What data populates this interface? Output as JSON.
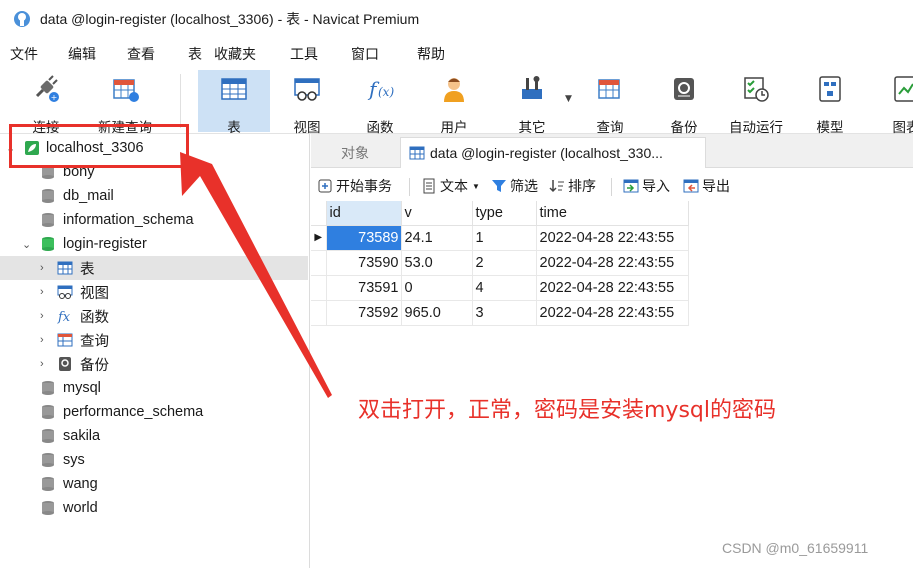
{
  "window": {
    "title": "data @login-register (localhost_3306) - 表 - Navicat Premium"
  },
  "menu": [
    "文件",
    "编辑",
    "查看",
    "表",
    "收藏夹",
    "工具",
    "窗口",
    "帮助"
  ],
  "toolbar": {
    "buttons": [
      {
        "label": "连接",
        "icon": "connection-icon"
      },
      {
        "label": "新建查询",
        "icon": "new-query-icon"
      },
      {
        "label": "表",
        "icon": "table-icon",
        "active": true
      },
      {
        "label": "视图",
        "icon": "view-icon"
      },
      {
        "label": "函数",
        "icon": "function-icon"
      },
      {
        "label": "用户",
        "icon": "user-icon"
      },
      {
        "label": "其它",
        "icon": "tools-icon"
      },
      {
        "label": "查询",
        "icon": "query-icon"
      },
      {
        "label": "备份",
        "icon": "backup-icon"
      },
      {
        "label": "自动运行",
        "icon": "automation-icon"
      },
      {
        "label": "模型",
        "icon": "model-icon"
      },
      {
        "label": "图表",
        "icon": "chart-icon"
      }
    ]
  },
  "sidebar": {
    "connection": "localhost_3306",
    "databases_before": [
      "bony",
      "db_mail",
      "information_schema"
    ],
    "open_database": "login-register",
    "children": [
      "表",
      "视图",
      "函数",
      "查询",
      "备份"
    ],
    "databases_after": [
      "mysql",
      "performance_schema",
      "sakila",
      "sys",
      "wang",
      "world"
    ]
  },
  "tabs": {
    "objects": "对象",
    "active": "data @login-register (localhost_330..."
  },
  "subtoolbar": {
    "begin_transaction": "开始事务",
    "text": "文本",
    "filter": "筛选",
    "sort": "排序",
    "import": "导入",
    "export": "导出"
  },
  "grid": {
    "columns": [
      "id",
      "v",
      "type",
      "time"
    ],
    "rows": [
      [
        "73589",
        "24.1",
        "1",
        "2022-04-28 22:43:55"
      ],
      [
        "73590",
        "53.0",
        "2",
        "2022-04-28 22:43:55"
      ],
      [
        "73591",
        "0",
        "4",
        "2022-04-28 22:43:55"
      ],
      [
        "73592",
        "965.0",
        "3",
        "2022-04-28 22:43:55"
      ]
    ]
  },
  "annotation": "双击打开，正常，密码是安装mysql的密码",
  "watermark": "CSDN @m0_61659911",
  "colors": {
    "annotation": "#e8312a",
    "selected_cell": "#2f7fe0",
    "active_toolbar": "#cde1f5"
  }
}
